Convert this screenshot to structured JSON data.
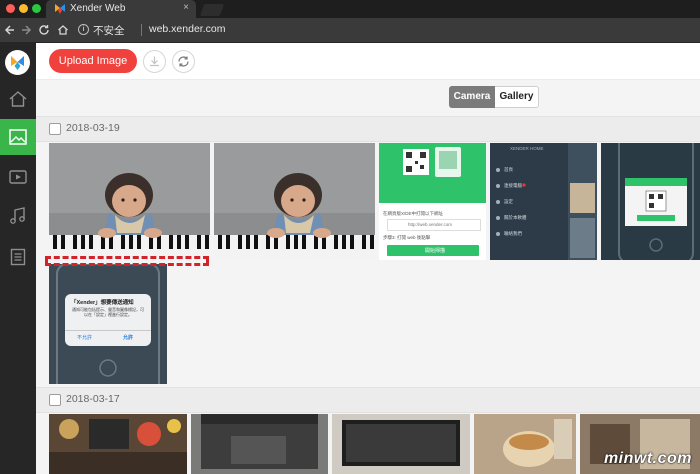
{
  "browser": {
    "tab_title": "Xender Web",
    "security_label": "不安全",
    "url": "web.xender.com"
  },
  "toolbar": {
    "upload_label": "Upload Image"
  },
  "view_toggle": {
    "options": [
      "Camera",
      "Gallery"
    ],
    "selected": "Camera"
  },
  "sections": [
    {
      "date": "2018-03-19",
      "photos": [
        "baby-piano-photo-1",
        "baby-piano-photo-2",
        "xender-connect-screenshot",
        "xender-menu-screenshot",
        "xender-qr-phone-screenshot",
        "xender-notification-dialog-screenshot"
      ]
    },
    {
      "date": "2018-03-17",
      "photos": [
        "desk-items-photo",
        "laptop-keyboard-photo",
        "monitor-photo",
        "food-bowl-photo",
        "table-items-photo"
      ]
    }
  ],
  "screenshot_texts": {
    "connect_notice": "在網頁版X/DE中打開以下網址",
    "connect_url": "http://web.xender.com",
    "connect_hint": "步驟3: 打開 web 後點擊",
    "connect_button": "開始掃描",
    "menu_items": [
      "首頁",
      "連接電腦",
      "設定",
      "關於本軟體",
      "聯絡我們"
    ],
    "menu_header": "XENDER HOME",
    "dialog_title": "「Xender」想要傳送通知",
    "dialog_body": "通知可能包括提示、聲音和圖像標記，可以在「設定」裡進行設定。",
    "dialog_deny": "不允許",
    "dialog_allow": "允許"
  },
  "watermark": "minwt.com",
  "colors": {
    "accent_red": "#f0413d",
    "sidebar_active": "#39b54a",
    "sidebar_bg": "#262626",
    "xender_green": "#2ec26a"
  }
}
